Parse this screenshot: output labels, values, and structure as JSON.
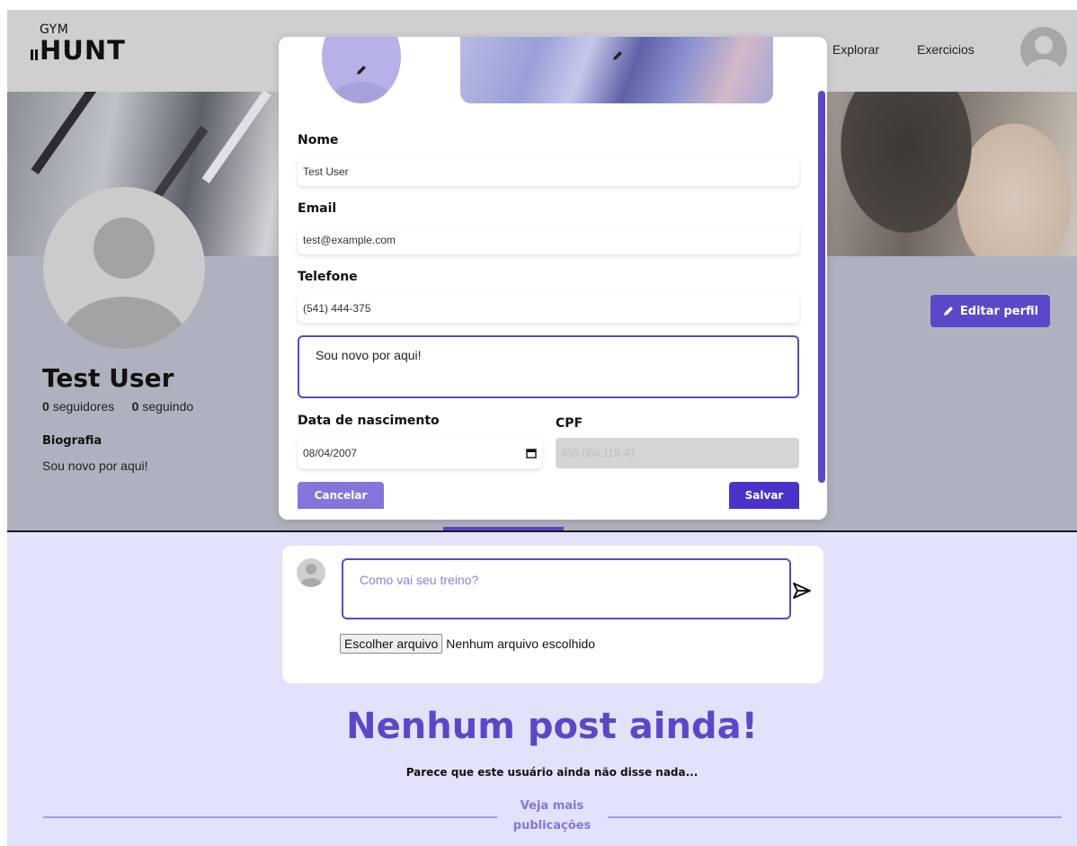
{
  "header": {
    "logo_top": "GYM",
    "logo_bottom": "HUNT",
    "nav": {
      "explorar": "Explorar",
      "exercicios": "Exercicios"
    }
  },
  "profile": {
    "name": "Test User",
    "followers_count": "0",
    "followers_label": "seguidores",
    "following_count": "0",
    "following_label": "seguindo",
    "bio_title": "Biografia",
    "bio_text": "Sou novo por aqui!",
    "edit_button": "Editar perfil"
  },
  "edit_modal": {
    "name_label": "Nome",
    "name_value": "Test User",
    "email_label": "Email",
    "email_value": "test@example.com",
    "phone_label": "Telefone",
    "phone_value": "(541) 444-375",
    "bio_value": "Sou novo por aqui!",
    "birthdate_label": "Data de nascimento",
    "birthdate_value": "08/04/2007",
    "cpf_label": "CPF",
    "cpf_value": "458.066.118-41",
    "cancel_button": "Cancelar",
    "save_button": "Salvar"
  },
  "composer": {
    "placeholder": "Como vai seu treino?",
    "file_button": "Escolher arquivo",
    "file_status": "Nenhum arquivo escolhido"
  },
  "empty_state": {
    "title": "Nenhum post ainda!",
    "subtitle": "Parece que este usuário ainda não disse nada...",
    "more_link_line1": "Veja mais",
    "more_link_line2": "publicações"
  },
  "colors": {
    "accent": "#5a48c8",
    "header_bg": "#cfcfd2",
    "profile_bg": "#aeb2bf",
    "feed_bg": "#e2e3fb"
  },
  "icons": [
    "pencil-icon",
    "send-icon",
    "calendar-icon",
    "avatar-placeholder-icon"
  ]
}
